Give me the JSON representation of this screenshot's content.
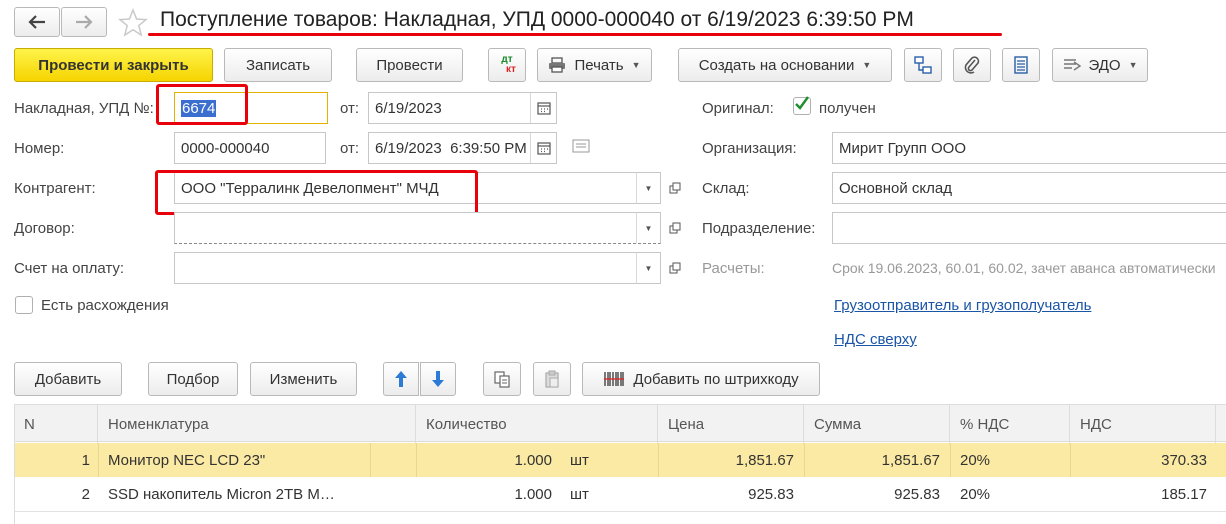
{
  "header": {
    "title": "Поступление товаров: Накладная, УПД 0000-000040 от 6/19/2023 6:39:50 PM"
  },
  "toolbar": {
    "post_close": "Провести и закрыть",
    "save": "Записать",
    "post": "Провести",
    "dt_kt_top": "дт",
    "dt_kt_bottom": "кт",
    "print": "Печать",
    "create_based": "Создать на основании",
    "edo": "ЭДО"
  },
  "form": {
    "invoice_label": "Накладная, УПД №:",
    "invoice_value": "6674",
    "from_label": "от:",
    "invoice_date": "6/19/2023",
    "number_label": "Номер:",
    "number_value": "0000-000040",
    "from_label2": "от:",
    "number_datetime": "6/19/2023  6:39:50 PM",
    "counterparty_label": "Контрагент:",
    "counterparty_value": "ООО \"Терралинк Девелопмент\" МЧД",
    "contract_label": "Договор:",
    "contract_value": "",
    "payment_label": "Счет на оплату:",
    "payment_value": "",
    "discrepancy_label": "Есть расхождения",
    "original_label": "Оригинал:",
    "original_value": "получен",
    "org_label": "Организация:",
    "org_value": "Мирит Групп ООО",
    "warehouse_label": "Склад:",
    "warehouse_value": "Основной склад",
    "department_label": "Подразделение:",
    "department_value": "",
    "settlements_label": "Расчеты:",
    "settlements_value": "Срок 19.06.2023, 60.01, 60.02, зачет аванса автоматически",
    "link_shipper": "Грузоотправитель и грузополучатель",
    "link_vat": "НДС сверху"
  },
  "table_toolbar": {
    "add": "Добавить",
    "pick": "Подбор",
    "edit": "Изменить",
    "barcode": "Добавить по штрихкоду"
  },
  "table": {
    "columns": [
      "N",
      "Номенклатура",
      "Количество",
      "Цена",
      "Сумма",
      "% НДС",
      "НДС"
    ],
    "rows": [
      {
        "n": "1",
        "name": "Монитор NEC LCD 23\"",
        "qty": "1.000",
        "unit": "шт",
        "price": "1,851.67",
        "sum": "1,851.67",
        "vat_rate": "20%",
        "vat": "370.33"
      },
      {
        "n": "2",
        "name": "SSD накопитель Micron 2TB M…",
        "qty": "1.000",
        "unit": "шт",
        "price": "925.83",
        "sum": "925.83",
        "vat_rate": "20%",
        "vat": "185.17"
      }
    ]
  },
  "colors": {
    "accent_yellow": "#f5d400",
    "annotation_red": "#e8000b",
    "link_blue": "#1a55a6",
    "selected_row": "#fbeaa3"
  }
}
